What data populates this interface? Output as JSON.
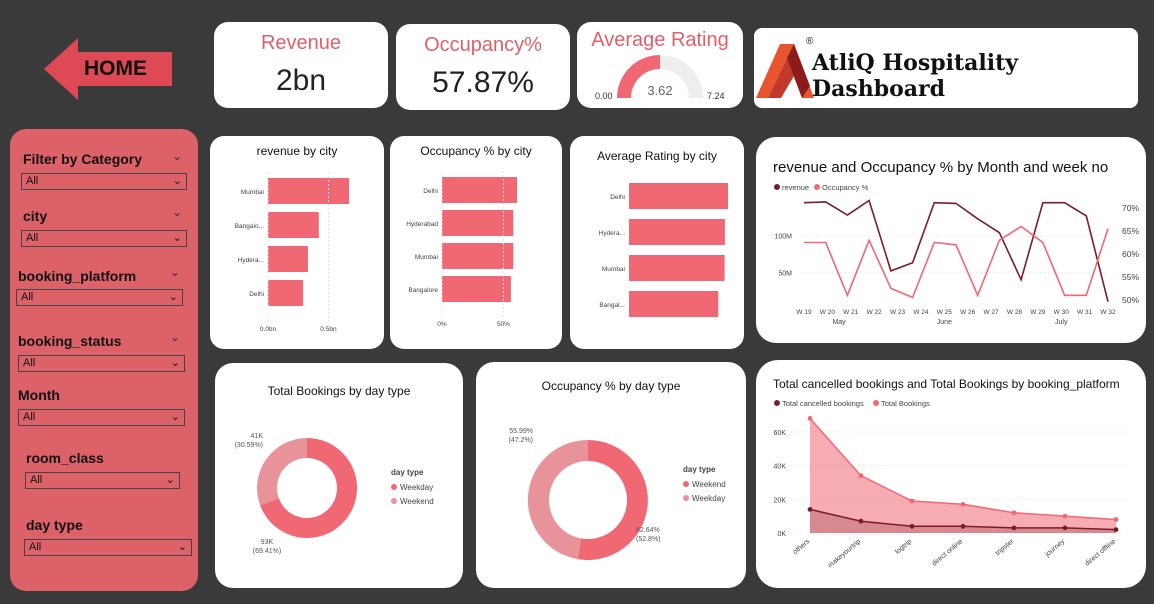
{
  "home": {
    "label": "HOME",
    "color": "#dd4955"
  },
  "kpis": {
    "revenue": {
      "label": "Revenue",
      "value": "2bn"
    },
    "occupancy": {
      "label": "Occupancy%",
      "value": "57.87%"
    },
    "rating": {
      "label": "Average Rating",
      "value": "3.62",
      "min": "0.00",
      "max": "7.24",
      "fraction": 0.5
    }
  },
  "brand": {
    "title": "AtliQ Hospitality Dashboard",
    "reg": "®"
  },
  "filters": [
    {
      "label": "Filter by Category",
      "value": "All"
    },
    {
      "label": "city",
      "value": "All"
    },
    {
      "label": "booking_platform",
      "value": "All"
    },
    {
      "label": "booking_status",
      "value": "All"
    },
    {
      "label": "Month",
      "value": "All"
    },
    {
      "label": "room_class",
      "value": "All"
    },
    {
      "label": "day type",
      "value": "All"
    }
  ],
  "colors": {
    "accent": "#ef6873",
    "dark": "#7b1c2a",
    "light": "#e8939a",
    "panel": "#dd6169"
  },
  "chart_data": [
    {
      "id": "revenue_by_city",
      "type": "bar",
      "orientation": "horizontal",
      "title": "revenue by city",
      "categories": [
        "Mumbai",
        "Bangalo...",
        "Hydera...",
        "Delhi"
      ],
      "values": [
        0.67,
        0.42,
        0.33,
        0.29
      ],
      "xlim": [
        0,
        0.5
      ],
      "xticks": [
        "0.0bn",
        "0.5bn"
      ]
    },
    {
      "id": "occupancy_by_city",
      "type": "bar",
      "orientation": "horizontal",
      "title": "Occupancy % by city",
      "categories": [
        "Delhi",
        "Hyderabad",
        "Mumbai",
        "Bangalore"
      ],
      "values": [
        61,
        58,
        58,
        56
      ],
      "xlim": [
        0,
        50
      ],
      "xticks": [
        "0%",
        "50%"
      ]
    },
    {
      "id": "rating_by_city",
      "type": "bar",
      "orientation": "horizontal",
      "title": "Average Rating by city",
      "categories": [
        "Delhi",
        "Hydera...",
        "Mumbai",
        "Bangal..."
      ],
      "values": [
        3.78,
        3.66,
        3.65,
        3.41
      ]
    },
    {
      "id": "rev_occ_by_week",
      "type": "line",
      "title": "revenue and Occupancy % by Month and week no",
      "x": [
        "W 19",
        "W 20",
        "W 21",
        "W 22",
        "W 23",
        "W 24",
        "W 25",
        "W 26",
        "W 27",
        "W 28",
        "W 29",
        "W 30",
        "W 31",
        "W 32"
      ],
      "months": [
        {
          "label": "May",
          "from": 0,
          "to": 3
        },
        {
          "label": "June",
          "from": 4,
          "to": 8
        },
        {
          "label": "July",
          "from": 9,
          "to": 13
        }
      ],
      "series": [
        {
          "name": "revenue",
          "axis": "left",
          "values": [
            145,
            146,
            128,
            148,
            52,
            63,
            145,
            144,
            123,
            104,
            40,
            145,
            145,
            127,
            10
          ]
        },
        {
          "name": "Occupancy %",
          "axis": "right",
          "values": [
            62.5,
            62.5,
            51,
            63,
            52.5,
            50.5,
            62.5,
            62,
            51,
            63,
            66,
            62.5,
            51,
            51,
            65.5
          ]
        }
      ],
      "yticks_left": [
        "50M",
        "100M"
      ],
      "yticks_right": [
        "50%",
        "55%",
        "60%",
        "65%",
        "70%"
      ],
      "y_left_lim": [
        0,
        150
      ],
      "y_right_lim": [
        48,
        72
      ]
    },
    {
      "id": "bookings_by_daytype",
      "type": "pie",
      "donut": true,
      "title": "Total Bookings by day type",
      "legend_title": "day type",
      "categories": [
        "Weekday",
        "Weekend"
      ],
      "values": [
        93,
        41
      ],
      "labels": [
        {
          "value": "93K",
          "pct": "(69.41%)"
        },
        {
          "value": "41K",
          "pct": "(30.59%)"
        }
      ]
    },
    {
      "id": "occupancy_by_daytype",
      "type": "pie",
      "donut": true,
      "title": "Occupancy % by day type",
      "legend_title": "day type",
      "categories": [
        "Weekend",
        "Weekday"
      ],
      "values": [
        62.64,
        55.99
      ],
      "labels": [
        {
          "value": "62.64%",
          "pct": "(52.8%)"
        },
        {
          "value": "55.99%",
          "pct": "(47.2%)"
        }
      ]
    },
    {
      "id": "cancelled_by_platform",
      "type": "area",
      "title": "Total cancelled bookings and Total Bookings by booking_platform",
      "categories": [
        "others",
        "makeyourtrip",
        "logtrip",
        "direct online",
        "tripster",
        "journey",
        "direct offline"
      ],
      "series": [
        {
          "name": "Total cancelled bookings",
          "values": [
            14,
            7,
            4,
            4,
            3,
            3,
            2
          ]
        },
        {
          "name": "Total Bookings",
          "values": [
            68,
            34,
            19,
            17,
            12,
            10,
            8
          ]
        }
      ],
      "ylim": [
        0,
        70
      ],
      "yticks": [
        "0K",
        "20K",
        "40K",
        "60K"
      ]
    }
  ]
}
